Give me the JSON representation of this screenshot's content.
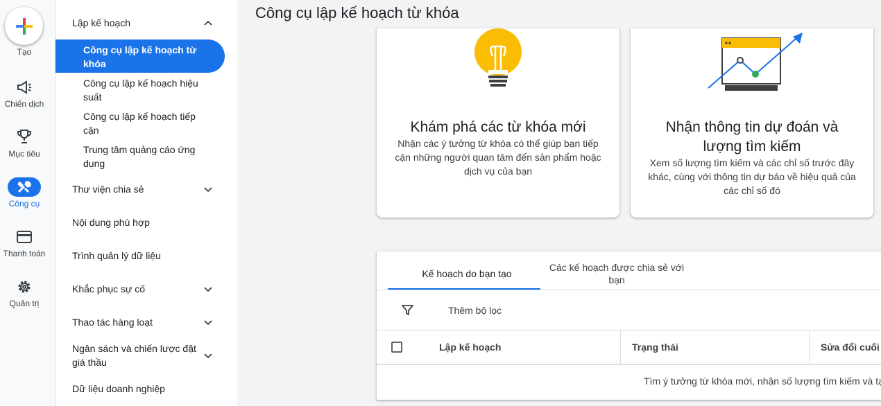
{
  "rail": {
    "create_label": "Tạo",
    "items": [
      {
        "label": "Chiến dịch",
        "icon": "campaign-icon"
      },
      {
        "label": "Mục tiêu",
        "icon": "trophy-icon"
      },
      {
        "label": "Công cụ",
        "icon": "tools-icon",
        "active": true
      },
      {
        "label": "Thanh toán",
        "icon": "credit-card-icon"
      },
      {
        "label": "Quản trị",
        "icon": "gear-icon"
      }
    ]
  },
  "nav": {
    "section": "Lập kế hoạch",
    "sub_items": [
      "Công cụ lập kế hoạch từ khóa",
      "Công cụ lập kế hoạch hiệu suất",
      "Công cụ lập kế hoạch tiếp cận",
      "Trung tâm quảng cáo ứng dụng"
    ],
    "items": [
      "Thư viện chia sẻ",
      "Nội dung phù hợp",
      "Trình quản lý dữ liệu",
      "Khắc phục sự cố",
      "Thao tác hàng loạt",
      "Ngân sách và chiến lược đặt giá thầu",
      "Dữ liệu doanh nghiệp"
    ]
  },
  "page": {
    "title": "Công cụ lập kế hoạch từ khóa"
  },
  "cards": [
    {
      "title": "Khám phá các từ khóa mới",
      "desc": "Nhận các ý tưởng từ khóa có thể giúp bạn tiếp cận những người quan tâm đến sản phẩm hoặc dịch vụ của bạn"
    },
    {
      "title": "Nhận thông tin dự đoán và lượng tìm kiếm",
      "desc": "Xem số lượng tìm kiếm và các chỉ số trước đây khác, cùng với thông tin dự báo về hiệu quả của các chỉ số đó"
    }
  ],
  "plans": {
    "tabs": [
      "Kế hoạch do bạn tạo",
      "Các kế hoạch được chia sẻ với bạn"
    ],
    "filter_label": "Thêm bộ lọc",
    "columns": [
      "Lập kế hoạch",
      "Trạng thái",
      "Sửa đổi cuối c"
    ],
    "empty_text": "Tìm ý tưởng từ khóa mới, nhận số lượng tìm kiếm và tạo"
  },
  "colors": {
    "accent": "#1a73e8",
    "bulb": "#fbbc04",
    "green": "#34a853"
  }
}
